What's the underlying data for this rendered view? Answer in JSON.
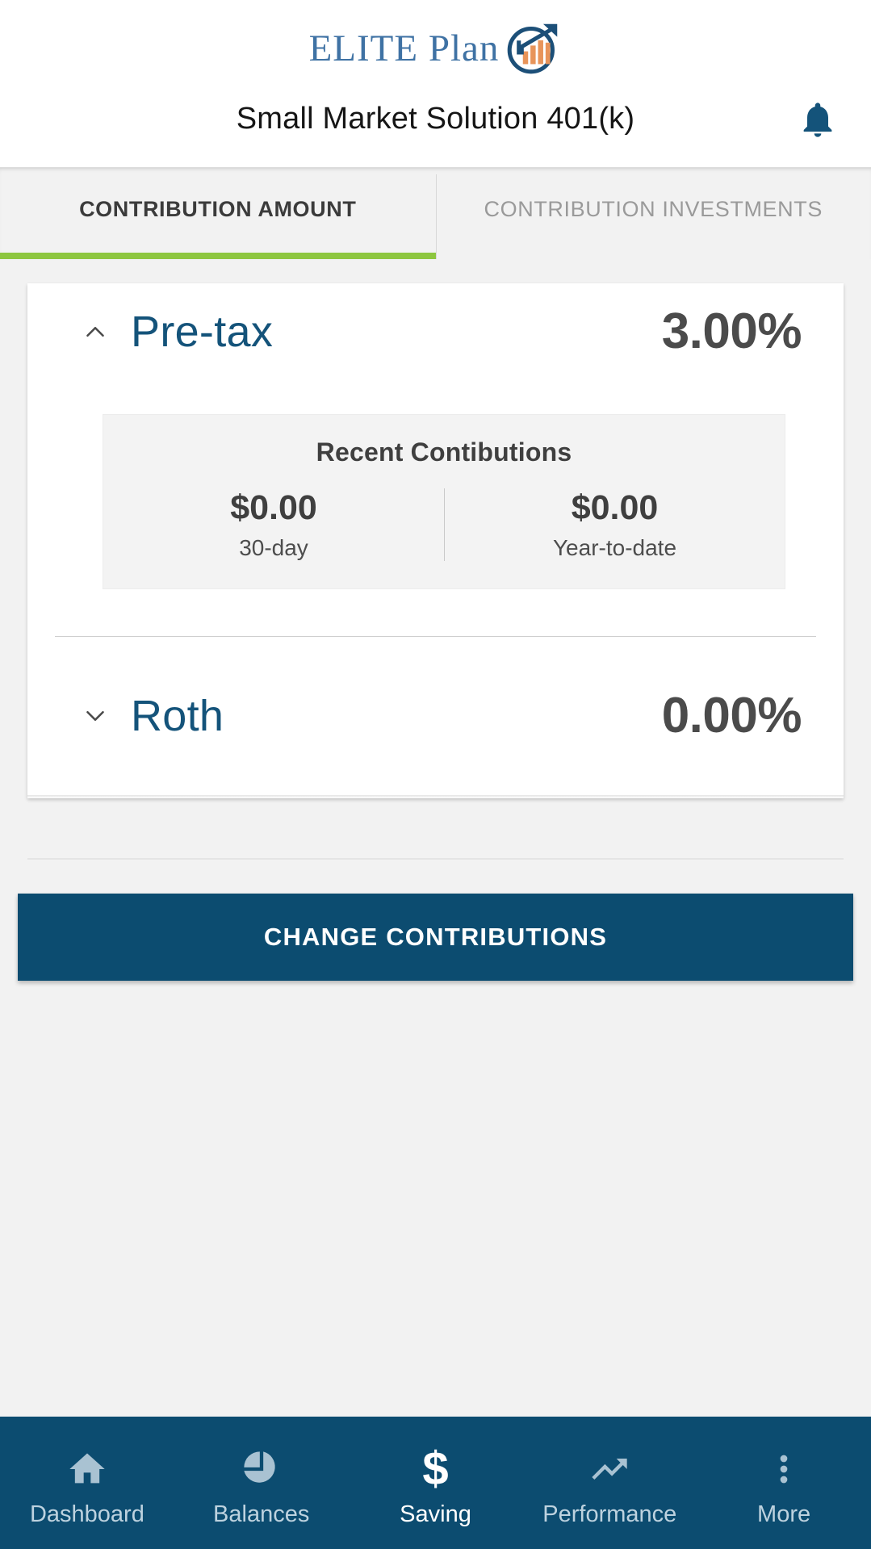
{
  "header": {
    "brand_text": "ELITE Plan",
    "brand_icon": "growth-chart-circle-logo",
    "title": "Small Market Solution 401(k)",
    "bell_icon": "notification-bell-icon"
  },
  "tabs": [
    {
      "label": "CONTRIBUTION AMOUNT",
      "active": true
    },
    {
      "label": "CONTRIBUTION INVESTMENTS",
      "active": false
    }
  ],
  "accounts": [
    {
      "name": "Pre-tax",
      "percent": "3.00%",
      "expanded": true,
      "chevron_icon": "chevron-up-icon",
      "recent": {
        "title": "Recent Contibutions",
        "stats": [
          {
            "value": "$0.00",
            "label": "30-day"
          },
          {
            "value": "$0.00",
            "label": "Year-to-date"
          }
        ]
      }
    },
    {
      "name": "Roth",
      "percent": "0.00%",
      "expanded": false,
      "chevron_icon": "chevron-down-icon"
    }
  ],
  "cta": {
    "label": "CHANGE CONTRIBUTIONS"
  },
  "bottom_nav": [
    {
      "label": "Dashboard",
      "icon": "home-icon",
      "active": false
    },
    {
      "label": "Balances",
      "icon": "pie-chart-icon",
      "active": false
    },
    {
      "label": "Saving",
      "icon": "dollar-sign-icon",
      "active": true
    },
    {
      "label": "Performance",
      "icon": "trending-up-icon",
      "active": false
    },
    {
      "label": "More",
      "icon": "more-vert-icon",
      "active": false
    }
  ],
  "colors": {
    "brand_blue": "#14537a",
    "nav_blue": "#0c4c70",
    "accent_green": "#8dc63f",
    "logo_orange": "#e8945a",
    "page_bg": "#f2f2f2"
  }
}
